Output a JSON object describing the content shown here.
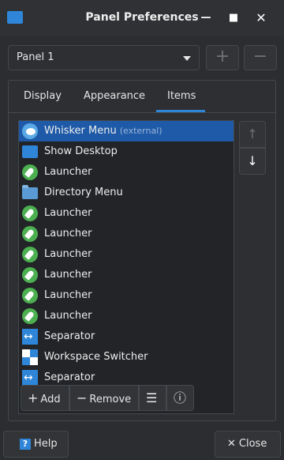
{
  "window": {
    "title": "Panel Preferences"
  },
  "panel_selector": {
    "value": "Panel 1"
  },
  "tabs": [
    {
      "label": "Display"
    },
    {
      "label": "Appearance"
    },
    {
      "label": "Items"
    }
  ],
  "items": [
    {
      "label": "Whisker Menu",
      "suffix": "(external)",
      "icon": "whisker-menu-icon"
    },
    {
      "label": "Show Desktop",
      "icon": "show-desktop-icon"
    },
    {
      "label": "Launcher",
      "icon": "launcher-icon"
    },
    {
      "label": "Directory Menu",
      "icon": "folder-icon"
    },
    {
      "label": "Launcher",
      "icon": "launcher-icon"
    },
    {
      "label": "Launcher",
      "icon": "launcher-icon"
    },
    {
      "label": "Launcher",
      "icon": "launcher-icon"
    },
    {
      "label": "Launcher",
      "icon": "launcher-icon"
    },
    {
      "label": "Launcher",
      "icon": "launcher-icon"
    },
    {
      "label": "Launcher",
      "icon": "launcher-icon"
    },
    {
      "label": "Separator",
      "icon": "separator-icon"
    },
    {
      "label": "Workspace Switcher",
      "icon": "workspace-switcher-icon"
    },
    {
      "label": "Separator",
      "icon": "separator-icon"
    }
  ],
  "toolbar": {
    "add_label": "Add",
    "remove_label": "Remove"
  },
  "footer": {
    "help_label": "Help",
    "close_label": "Close"
  },
  "colors": {
    "accent": "#2f86d8",
    "selection": "#1e5aa8",
    "launcher": "#4caf50"
  }
}
